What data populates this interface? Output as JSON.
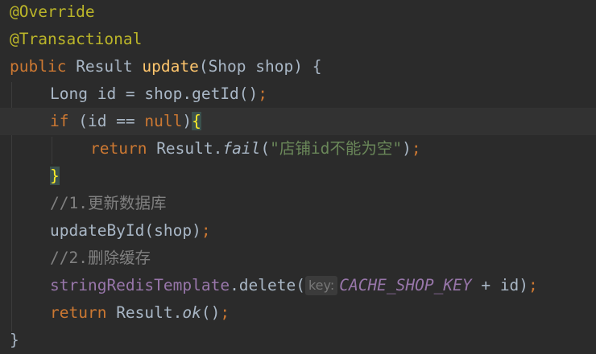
{
  "code": {
    "l1": {
      "ann": "@Override"
    },
    "l2": {
      "ann": "@Transactional"
    },
    "l3": {
      "kw": "public",
      "t1": " Result ",
      "fn": "update",
      "t2": "(Shop shop) {"
    },
    "l4": {
      "t1": "Long id = shop.getId()",
      "semi": ";"
    },
    "l5": {
      "kw_if": "if",
      "t1": " (id == ",
      "kw_null": "null",
      "t2": ")",
      "brace": "{"
    },
    "l6": {
      "kw": "return",
      "t1": " Result.",
      "m": "fail",
      "t2": "(",
      "str": "\"店铺id不能为空\"",
      "t3": ")",
      "semi": ";"
    },
    "l7": {
      "brace": "}"
    },
    "l8": {
      "comment": "//1.更新数据库"
    },
    "l9": {
      "t1": "updateById(shop)",
      "semi": ";"
    },
    "l10": {
      "comment": "//2.删除缓存"
    },
    "l11": {
      "field": "stringRedisTemplate",
      "t1": ".delete(",
      "hint": "key:",
      "const": "CACHE_SHOP_KEY",
      "t2": " + id)",
      "semi": ";"
    },
    "l12": {
      "kw": "return",
      "t1": " Result.",
      "m": "ok",
      "t2": "()",
      "semi": ";"
    },
    "l13": {
      "t1": "}"
    }
  }
}
